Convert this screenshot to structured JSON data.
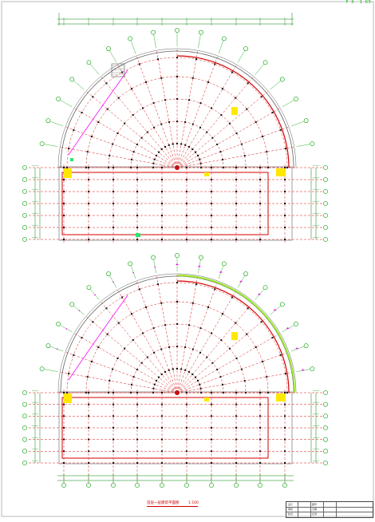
{
  "drawing": {
    "corner_tag": [
      "F 3",
      "1 05"
    ],
    "title": "首层一层建筑平面图",
    "scale": "1:100"
  },
  "palette": {
    "axis": "#d40000",
    "wall": "#d40000",
    "bubble": "#00a000",
    "outline": "#606060",
    "column": "#111111",
    "fill_yellow": "#ffe800",
    "fill_green": "#2ee66d",
    "dim": "#008000",
    "arc_accent": "#ff00ff",
    "arc_green": "#9be82a"
  },
  "title_block": {
    "cells": [
      "设计",
      "审核",
      "校对",
      "图号",
      "日期",
      "比例"
    ]
  }
}
